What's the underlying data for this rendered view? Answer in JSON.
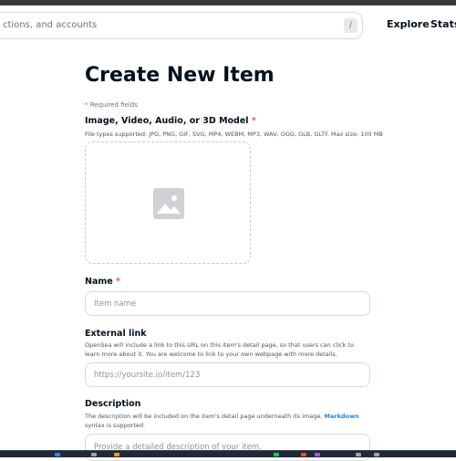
{
  "header": {
    "search_placeholder": "ctions, and accounts",
    "search_shortcut": "/",
    "nav": {
      "explore": "Explore",
      "stats": "Stats"
    }
  },
  "form": {
    "title": "Create New Item",
    "required_note_star": "*",
    "required_note": "Required fields",
    "media": {
      "label": "Image, Video, Audio, or 3D Model",
      "required_star": "*",
      "help": "File types supported: JPG, PNG, GIF, SVG, MP4, WEBM, MP3, WAV, OGG, GLB, GLTF. Max size: 100 MB",
      "icon": "image-placeholder-icon"
    },
    "name": {
      "label": "Name",
      "required_star": "*",
      "placeholder": "Item name"
    },
    "external_link": {
      "label": "External link",
      "help": "OpenSea will include a link to this URL on this item's detail page, so that users can click to learn more about it. You are welcome to link to your own webpage with more details.",
      "placeholder": "https://yoursite.io/item/123"
    },
    "description": {
      "label": "Description",
      "help_before": "The description will be included on the item's detail page underneath its image.",
      "help_link": "Markdown",
      "help_after": "syntax is supported.",
      "placeholder": "Provide a detailed description of your item."
    }
  },
  "colors": {
    "required": "#eb5757",
    "link": "#2081e2",
    "text": "#04111d",
    "border": "#d7dade"
  }
}
